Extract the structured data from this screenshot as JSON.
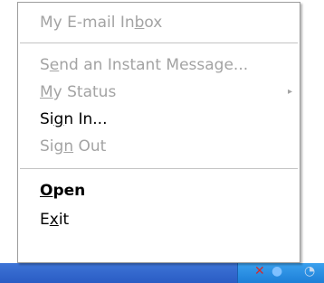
{
  "menu": {
    "items": [
      {
        "pre": "My E-mail In",
        "ul": "b",
        "post": "ox",
        "state": "disabled"
      },
      {
        "pre": "S",
        "ul": "e",
        "post": "nd an Instant Message...",
        "state": "disabled"
      },
      {
        "pre": "",
        "ul": "M",
        "post": "y Status",
        "state": "disabled"
      },
      {
        "pre": "Si",
        "ul": "g",
        "post": "n In...",
        "state": "enabled"
      },
      {
        "pre": "Sig",
        "ul": "n",
        "post": " Out",
        "state": "disabled"
      },
      {
        "pre": "",
        "ul": "O",
        "post": "pen",
        "state": "default"
      },
      {
        "pre": "E",
        "ul": "x",
        "post": "it",
        "state": "enabled"
      }
    ],
    "submenu_arrow": "▸"
  },
  "tray": {
    "icons": [
      "network-error-icon",
      "messenger-icon",
      "clock-icon"
    ]
  }
}
